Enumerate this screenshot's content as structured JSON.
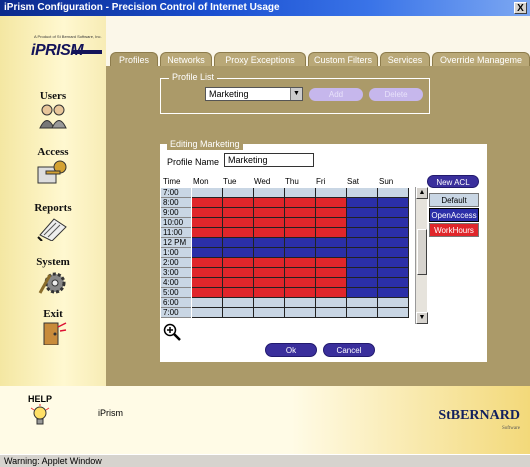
{
  "window": {
    "title": "iPrism Configuration - Precision Control of Internet Usage",
    "close_label": "X"
  },
  "logo": {
    "text": "iPRISM",
    "small": "A Product of St Bernard Software, Inc."
  },
  "nav": [
    {
      "label": "Users",
      "icon": "users-icon"
    },
    {
      "label": "Access",
      "icon": "access-key-icon"
    },
    {
      "label": "Reports",
      "icon": "reports-icon"
    },
    {
      "label": "System",
      "icon": "system-gear-icon"
    },
    {
      "label": "Exit",
      "icon": "exit-icon"
    }
  ],
  "tabs": [
    "Profiles",
    "Networks",
    "Proxy Exceptions",
    "Custom Filters",
    "Services",
    "Override Manageme"
  ],
  "profile_list": {
    "legend": "Profile List",
    "selected": "Marketing",
    "add_label": "Add",
    "delete_label": "Delete"
  },
  "editing": {
    "legend": "Editing Marketing",
    "name_label": "Profile Name",
    "name_value": "Marketing"
  },
  "schedule": {
    "headers": [
      "Time",
      "Mon",
      "Tue",
      "Wed",
      "Thu",
      "Fri",
      "Sat",
      "Sun"
    ],
    "times": [
      "7:00",
      "8:00",
      "9:00",
      "10:00",
      "11:00",
      "12 PM",
      "1:00",
      "2:00",
      "3:00",
      "4:00",
      "5:00",
      "6:00",
      "7:00"
    ]
  },
  "acl": {
    "new_label": "New ACL",
    "items": [
      {
        "label": "Default",
        "color": "#c9d6e4"
      },
      {
        "label": "OpenAccess",
        "color": "#2b2fa8"
      },
      {
        "label": "WorkHours",
        "color": "#e0262b"
      }
    ]
  },
  "buttons": {
    "ok_label": "Ok",
    "cancel_label": "Cancel"
  },
  "footer": {
    "help_label": "HELP",
    "app_label": "iPrism",
    "brand": "StBERNARD",
    "brand_sub": "Software"
  },
  "status": "Warning: Applet Window",
  "colors": {
    "default": "#c9d6e4",
    "open": "#2b2fa8",
    "work": "#e0262b",
    "panel": "#ab9a69"
  }
}
